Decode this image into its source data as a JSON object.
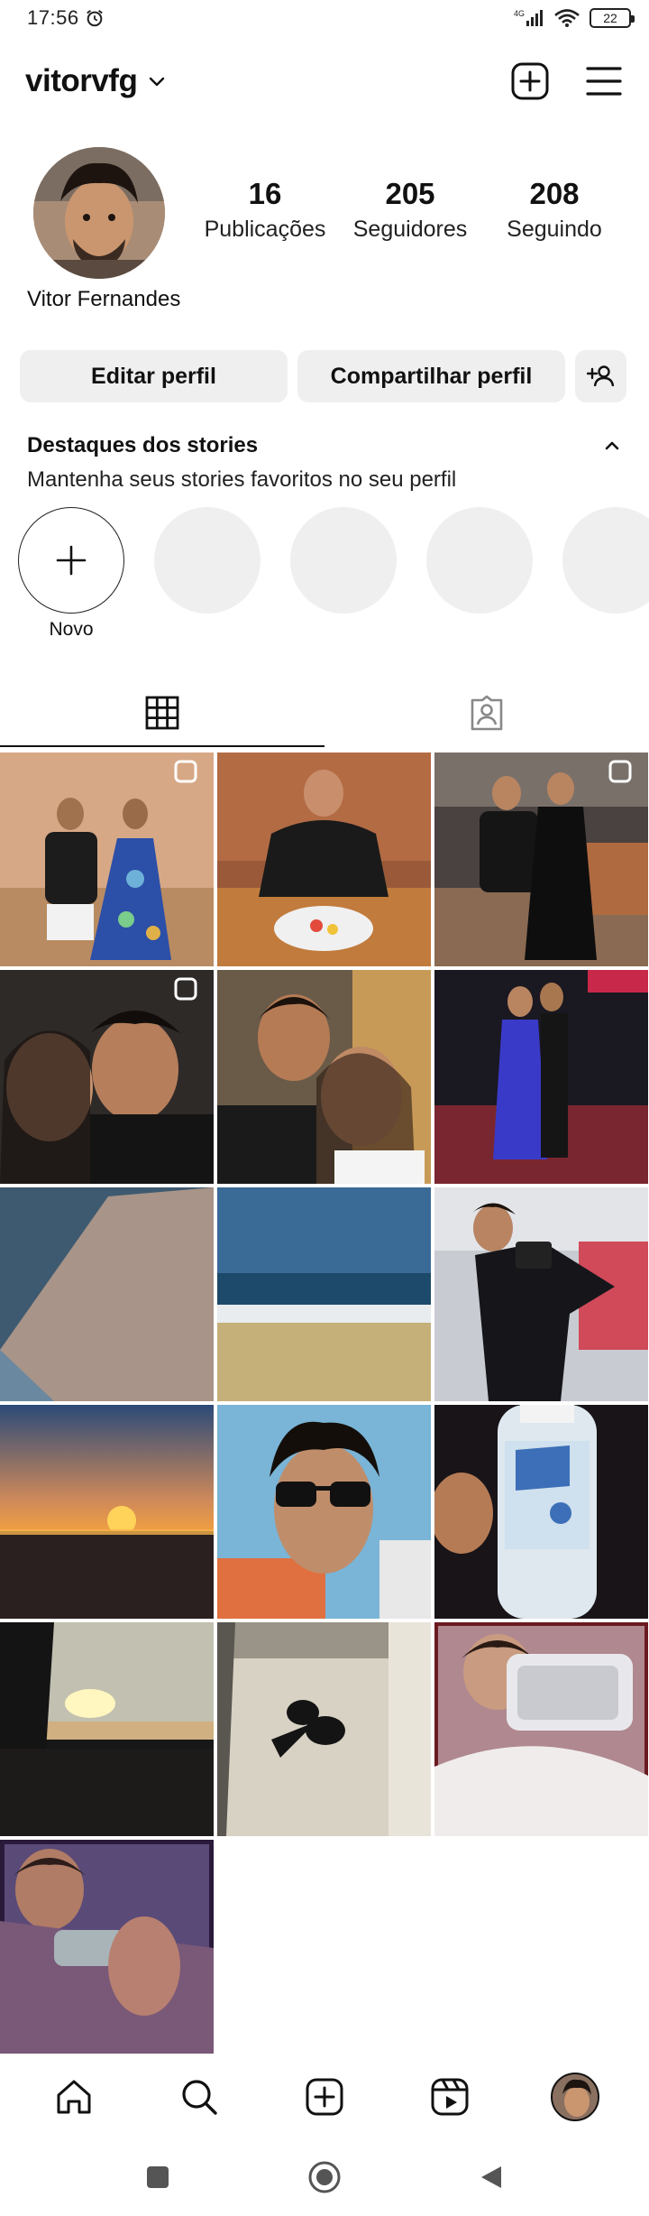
{
  "status_bar": {
    "time": "17:56",
    "network": "4G",
    "battery": "22"
  },
  "header": {
    "username": "vitorvfg"
  },
  "profile": {
    "name": "Vitor Fernandes",
    "stats": [
      {
        "value": "16",
        "label": "Publicações"
      },
      {
        "value": "205",
        "label": "Seguidores"
      },
      {
        "value": "208",
        "label": "Seguindo"
      }
    ]
  },
  "buttons": {
    "edit": "Editar perfil",
    "share": "Compartilhar perfil"
  },
  "highlights": {
    "title": "Destaques dos stories",
    "subtitle": "Mantenha seus stories favoritos no seu perfil",
    "new_label": "Novo"
  },
  "tabs": [
    {
      "name": "grid-icon",
      "active": true
    },
    {
      "name": "tagged-icon",
      "active": false
    }
  ],
  "colors": {
    "accent": "#111111",
    "button_bg": "#efefef",
    "placeholder": "#efefef"
  },
  "nav": [
    "home-icon",
    "search-icon",
    "create-icon",
    "reels-icon",
    "profile-avatar"
  ]
}
